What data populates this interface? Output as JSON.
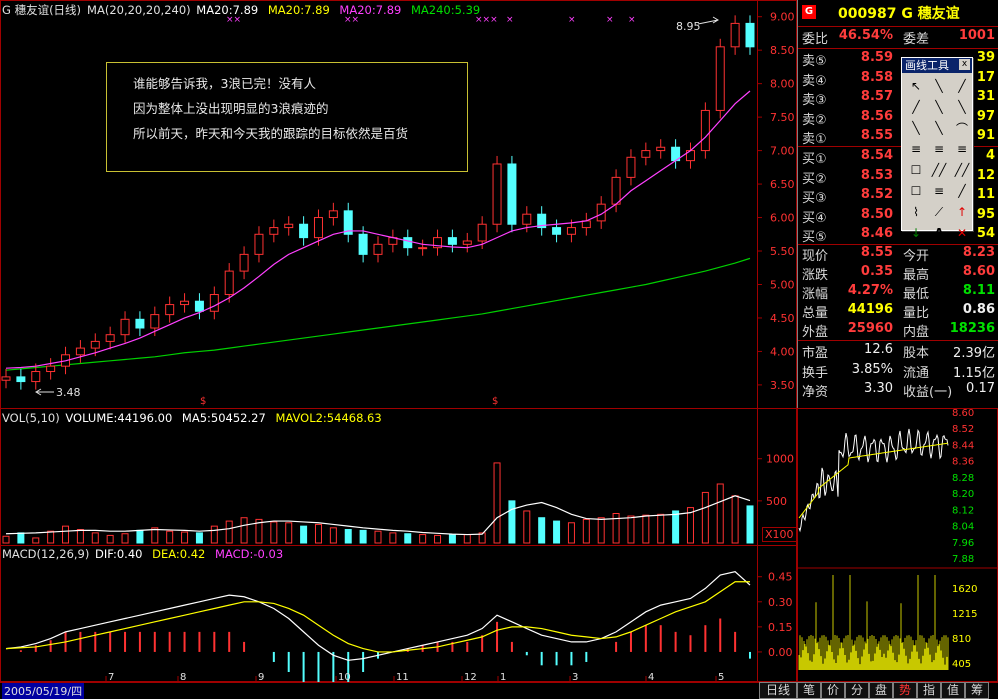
{
  "header": {
    "code_name": "G 穗友谊(日线)",
    "ma_label": "MA(20,20,20,240)",
    "ma1": "MA20:7.89",
    "ma2": "MA20:7.89",
    "ma3": "MA20:7.89",
    "ma4": "MA240:5.39"
  },
  "note": {
    "line1": "谁能够告诉我，3浪已完！没有人",
    "line2": "因为整体上没出现明显的3浪痕迹的",
    "line3": "所以前天，昨天和今天我的跟踪的目标依然是百货"
  },
  "annotations": {
    "high_label": "8.95",
    "low_label": "3.48"
  },
  "vol_header": {
    "name": "VOL(5,10)",
    "volume": "VOLUME:44196.00",
    "ma5": "MA5:50452.27",
    "mavol2": "MAVOL2:54468.63",
    "unit": "X100"
  },
  "macd_header": {
    "name": "MACD(12,26,9)",
    "dif": "DIF:0.40",
    "dea": "DEA:0.42",
    "macd": "MACD:-0.03"
  },
  "date_label": "2005/05/19/四",
  "month_ticks": [
    "7",
    "8",
    "9",
    "10",
    "11",
    "12",
    "1",
    "3",
    "4",
    "5"
  ],
  "colors": {
    "up": "#ff3232",
    "down": "#54ffff",
    "ma20": "#ff40ff",
    "ma240": "#00d000",
    "dif": "#ffffff",
    "dea": "#ffff00"
  },
  "chart_data": [
    {
      "type": "candlestick",
      "title": "",
      "yticks": [
        "9.00",
        "8.50",
        "8.00",
        "7.50",
        "7.00",
        "6.50",
        "6.00",
        "5.50",
        "5.00",
        "4.50",
        "4.00",
        "3.50"
      ],
      "ylim": [
        3.2,
        9.1
      ],
      "close_series": [
        3.62,
        3.55,
        3.7,
        3.78,
        3.95,
        4.05,
        4.15,
        4.25,
        4.48,
        4.35,
        4.55,
        4.7,
        4.75,
        4.6,
        4.85,
        5.2,
        5.45,
        5.75,
        5.85,
        5.9,
        5.7,
        6.0,
        6.1,
        5.75,
        5.45,
        5.6,
        5.7,
        5.55,
        5.55,
        5.7,
        5.6,
        5.65,
        5.9,
        6.8,
        5.9,
        6.05,
        5.85,
        5.75,
        5.85,
        5.95,
        6.2,
        6.6,
        6.9,
        7.0,
        7.05,
        6.85,
        7.0,
        7.6,
        8.55,
        8.9,
        8.55
      ],
      "ma20_series": [
        3.75,
        3.76,
        3.78,
        3.82,
        3.86,
        3.92,
        3.98,
        4.05,
        4.12,
        4.2,
        4.3,
        4.4,
        4.5,
        4.58,
        4.68,
        4.8,
        4.95,
        5.12,
        5.3,
        5.45,
        5.55,
        5.65,
        5.75,
        5.8,
        5.8,
        5.75,
        5.7,
        5.65,
        5.6,
        5.58,
        5.56,
        5.55,
        5.6,
        5.7,
        5.8,
        5.85,
        5.88,
        5.9,
        5.92,
        5.95,
        6.05,
        6.2,
        6.4,
        6.55,
        6.7,
        6.85,
        7.0,
        7.2,
        7.45,
        7.7,
        7.89
      ],
      "ma240_series": [
        3.72,
        3.74,
        3.76,
        3.78,
        3.8,
        3.82,
        3.84,
        3.86,
        3.88,
        3.9,
        3.92,
        3.95,
        3.98,
        4.0,
        4.02,
        4.05,
        4.08,
        4.11,
        4.14,
        4.17,
        4.2,
        4.23,
        4.26,
        4.29,
        4.32,
        4.35,
        4.38,
        4.41,
        4.44,
        4.47,
        4.5,
        4.53,
        4.56,
        4.6,
        4.64,
        4.68,
        4.72,
        4.76,
        4.8,
        4.84,
        4.88,
        4.92,
        4.96,
        5.0,
        5.05,
        5.1,
        5.15,
        5.2,
        5.26,
        5.32,
        5.39
      ]
    },
    {
      "type": "bar",
      "title": "VOL",
      "yticks": [
        "1000",
        "500"
      ],
      "ylim": [
        0,
        1400
      ],
      "values": [
        80,
        120,
        60,
        140,
        200,
        160,
        120,
        90,
        110,
        150,
        180,
        140,
        130,
        120,
        200,
        260,
        300,
        280,
        250,
        240,
        200,
        220,
        180,
        160,
        150,
        140,
        120,
        110,
        100,
        90,
        95,
        100,
        120,
        950,
        500,
        380,
        300,
        260,
        240,
        280,
        300,
        350,
        320,
        330,
        340,
        380,
        420,
        600,
        700,
        560,
        440
      ],
      "ma5": [
        110,
        115,
        120,
        130,
        140,
        150,
        150,
        140,
        140,
        150,
        160,
        155,
        150,
        140,
        150,
        170,
        210,
        240,
        260,
        260,
        250,
        240,
        220,
        200,
        180,
        165,
        150,
        140,
        125,
        115,
        105,
        100,
        105,
        300,
        400,
        450,
        480,
        420,
        340,
        290,
        280,
        290,
        300,
        320,
        330,
        340,
        360,
        420,
        490,
        560,
        504
      ]
    },
    {
      "type": "bar",
      "title": "MACD",
      "yticks": [
        "0.45",
        "0.30",
        "0.15",
        "0.00"
      ],
      "ylim": [
        -0.12,
        0.55
      ],
      "dif": [
        0.02,
        0.03,
        0.05,
        0.08,
        0.12,
        0.14,
        0.16,
        0.18,
        0.2,
        0.22,
        0.24,
        0.26,
        0.28,
        0.3,
        0.32,
        0.34,
        0.33,
        0.3,
        0.26,
        0.2,
        0.12,
        0.04,
        -0.02,
        -0.05,
        -0.04,
        -0.02,
        0.0,
        0.02,
        0.04,
        0.06,
        0.08,
        0.1,
        0.14,
        0.22,
        0.18,
        0.14,
        0.1,
        0.08,
        0.06,
        0.06,
        0.08,
        0.12,
        0.18,
        0.24,
        0.28,
        0.3,
        0.32,
        0.38,
        0.46,
        0.48,
        0.4
      ],
      "dea": [
        0.02,
        0.025,
        0.03,
        0.045,
        0.06,
        0.08,
        0.1,
        0.12,
        0.14,
        0.16,
        0.18,
        0.2,
        0.22,
        0.24,
        0.26,
        0.28,
        0.3,
        0.3,
        0.29,
        0.26,
        0.22,
        0.16,
        0.1,
        0.05,
        0.02,
        0.0,
        0.0,
        0.01,
        0.02,
        0.03,
        0.05,
        0.07,
        0.09,
        0.13,
        0.15,
        0.15,
        0.14,
        0.12,
        0.1,
        0.09,
        0.08,
        0.09,
        0.12,
        0.16,
        0.2,
        0.24,
        0.27,
        0.3,
        0.36,
        0.42,
        0.42
      ]
    }
  ],
  "quote": {
    "title": "000987 G 穗友谊",
    "wb_label": "委比",
    "wb_value": "46.54%",
    "wc_label": "委差",
    "wc_value": "1001",
    "asks": [
      {
        "label": "卖⑤",
        "price": "8.59",
        "vol": "39"
      },
      {
        "label": "卖④",
        "price": "8.58",
        "vol": "17"
      },
      {
        "label": "卖③",
        "price": "8.57",
        "vol": "31"
      },
      {
        "label": "卖②",
        "price": "8.56",
        "vol": "97"
      },
      {
        "label": "卖①",
        "price": "8.55",
        "vol": "91"
      }
    ],
    "bids": [
      {
        "label": "买①",
        "price": "8.54",
        "vol": "4"
      },
      {
        "label": "买②",
        "price": "8.53",
        "vol": "12"
      },
      {
        "label": "买③",
        "price": "8.52",
        "vol": "11"
      },
      {
        "label": "买④",
        "price": "8.50",
        "vol": "95"
      },
      {
        "label": "买⑤",
        "price": "8.46",
        "vol": "54"
      }
    ],
    "stats": [
      {
        "l1": "现价",
        "v1": "8.55",
        "c1": "red",
        "l2": "今开",
        "v2": "8.23",
        "c2": "red"
      },
      {
        "l1": "涨跌",
        "v1": "0.35",
        "c1": "red",
        "l2": "最高",
        "v2": "8.60",
        "c2": "red"
      },
      {
        "l1": "涨幅",
        "v1": "4.27%",
        "c1": "red",
        "l2": "最低",
        "v2": "8.11",
        "c2": "green"
      },
      {
        "l1": "总量",
        "v1": "44196",
        "c1": "yellow",
        "l2": "量比",
        "v2": "0.86",
        "c2": "white"
      },
      {
        "l1": "外盘",
        "v1": "25960",
        "c1": "red",
        "l2": "内盘",
        "v2": "18236",
        "c2": "green"
      }
    ],
    "stats2": [
      {
        "l1": "市盈",
        "v1": "12.6",
        "l2": "股本",
        "v2": "2.39亿"
      },
      {
        "l1": "换手",
        "v1": "3.85%",
        "l2": "流通",
        "v2": "1.15亿"
      },
      {
        "l1": "净资",
        "v1": "3.30",
        "l2": "收益(一)",
        "v2": "0.17"
      }
    ]
  },
  "intraday": {
    "yticks": [
      "8.60",
      "8.52",
      "8.44",
      "8.36",
      "8.28",
      "8.20",
      "8.12",
      "8.04",
      "7.96",
      "7.88"
    ],
    "vol_ticks": [
      "1620",
      "1215",
      "810",
      "405"
    ]
  },
  "toolbox": {
    "title": "画线工具",
    "close": "x",
    "text_tool": "A"
  },
  "tabs": [
    "日线",
    "笔",
    "价",
    "分",
    "盘",
    "势",
    "指",
    "值",
    "筹"
  ]
}
